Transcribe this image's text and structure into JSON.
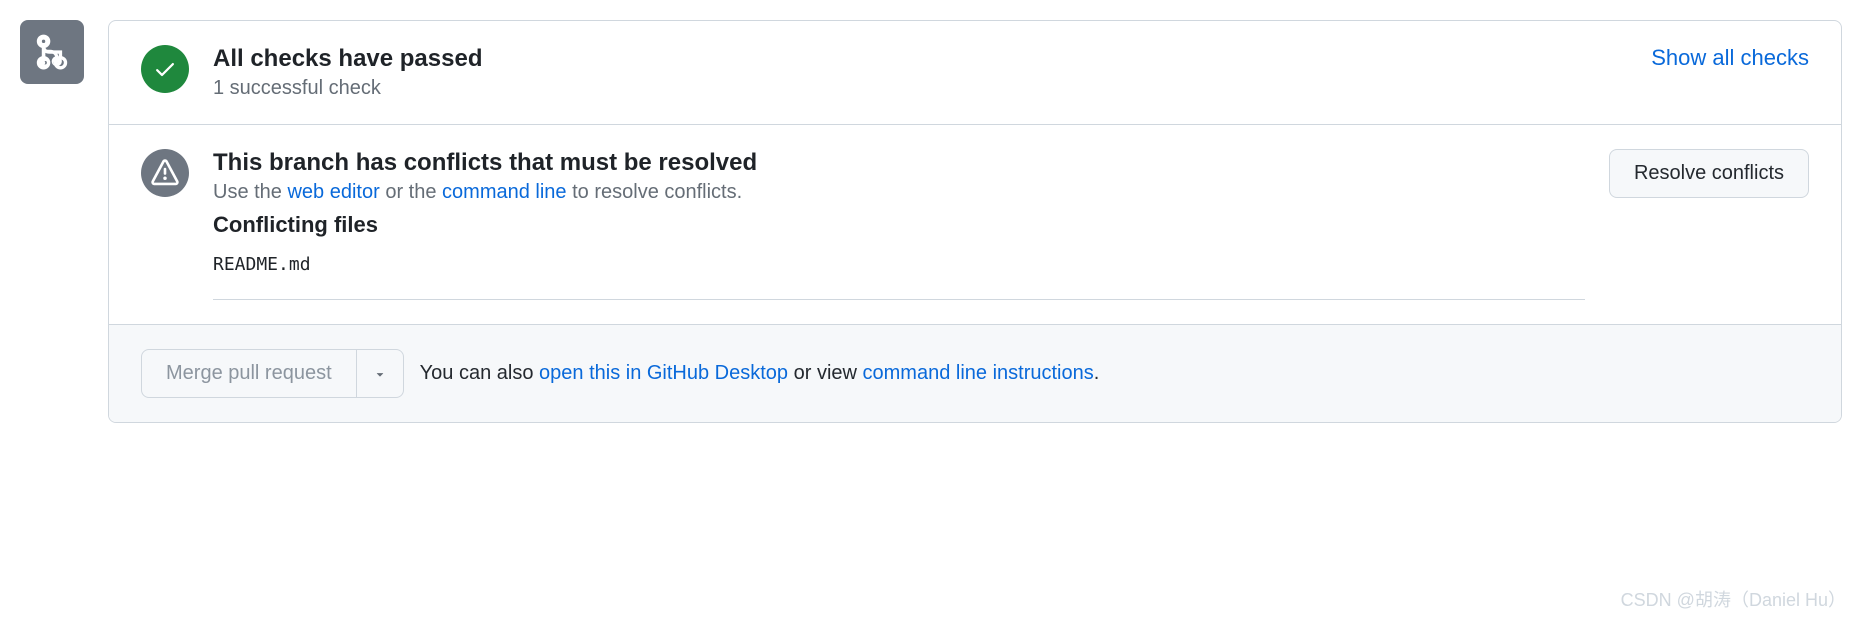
{
  "checks": {
    "title": "All checks have passed",
    "subtitle": "1 successful check",
    "show_all_label": "Show all checks"
  },
  "conflicts": {
    "title": "This branch has conflicts that must be resolved",
    "help_prefix": "Use the ",
    "web_editor_link": "web editor",
    "help_middle": " or the ",
    "command_line_link": "command line",
    "help_suffix": " to resolve conflicts.",
    "files_heading": "Conflicting files",
    "files": [
      "README.md"
    ],
    "resolve_button": "Resolve conflicts"
  },
  "merge": {
    "button_label": "Merge pull request",
    "alt_prefix": "You can also ",
    "open_desktop_link": "open this in GitHub Desktop",
    "alt_middle": " or view ",
    "cli_link": "command line instructions",
    "alt_suffix": "."
  },
  "watermark": "CSDN @胡涛（Daniel Hu）"
}
